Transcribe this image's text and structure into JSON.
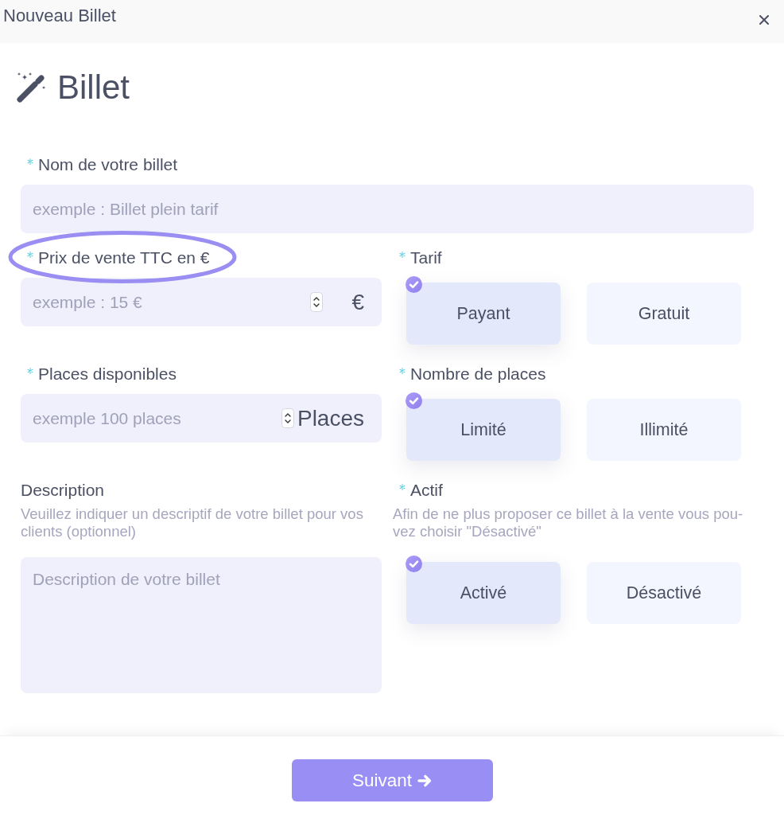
{
  "dialog": {
    "title": "Nouveau Billet"
  },
  "heading": {
    "title": "Billet"
  },
  "fields": [
    {
      "kind": "text",
      "label": "Nom de votre billet",
      "required": true,
      "highlighted": false,
      "placeholder": "exemple : Billet plein tarif"
    },
    {
      "kind": "number",
      "label": "Prix de vente TTC en €",
      "required": true,
      "highlighted": true,
      "placeholder": "exemple : 15 €",
      "unit": "€"
    },
    {
      "kind": "choice",
      "label": "Tarif",
      "required": true,
      "highlighted": false,
      "options": [
        {
          "label": "Payant",
          "selected": true
        },
        {
          "label": "Gratuit",
          "selected": false
        }
      ]
    },
    {
      "kind": "number",
      "label": "Places disponibles",
      "required": true,
      "highlighted": false,
      "placeholder": "exemple 100 places",
      "unit": "Places"
    },
    {
      "kind": "choice",
      "label": "Nombre de places",
      "required": true,
      "highlighted": false,
      "options": [
        {
          "label": "Limité",
          "selected": true
        },
        {
          "label": "Illimité",
          "selected": false
        }
      ]
    },
    {
      "kind": "textarea",
      "label": "Description",
      "required": false,
      "highlighted": false,
      "help": "Veuillez indiquer un descriptif de votre billet pour vos clients (optionnel)",
      "placeholder": "Description de votre billet"
    },
    {
      "kind": "choice",
      "label": "Actif",
      "required": true,
      "highlighted": false,
      "help": "Afin de ne plus proposer ce billet à la vente vous pou-vez choisir \"Désactivé\"",
      "options": [
        {
          "label": "Activé",
          "selected": true
        },
        {
          "label": "Désactivé",
          "selected": false
        }
      ]
    }
  ],
  "footer": {
    "button": "Suivant"
  }
}
